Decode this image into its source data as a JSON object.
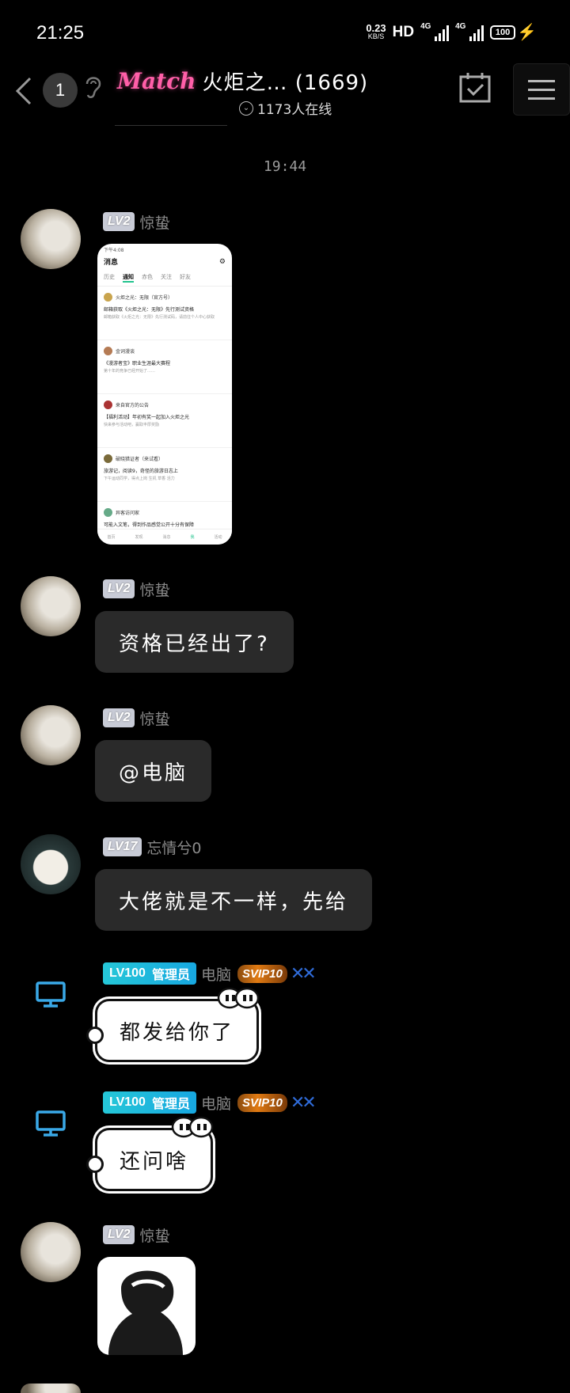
{
  "status_bar": {
    "time": "21:25",
    "net_speed_value": "0.23",
    "net_speed_unit": "KB/S",
    "hd_label": "HD",
    "signal1_label": "4G",
    "signal2_label": "4G",
    "battery": "100"
  },
  "header": {
    "back_badge": "1",
    "match_logo": "Match",
    "title": "火炬之… (1669)",
    "online": "1173人在线"
  },
  "timestamp": "19:44",
  "messages": [
    {
      "level": "LV2",
      "nick": "惊蛰",
      "type": "image"
    },
    {
      "level": "LV2",
      "nick": "惊蛰",
      "text": "资格已经出了?"
    },
    {
      "level": "LV2",
      "nick": "惊蛰",
      "text": "@电脑"
    },
    {
      "level": "LV17",
      "nick": "忘情兮0",
      "text": "大佬就是不一样，先给"
    },
    {
      "level": "LV100",
      "role": "管理员",
      "nick": "电脑",
      "vip": "SVIP10",
      "text": "都发给你了"
    },
    {
      "level": "LV100",
      "role": "管理员",
      "nick": "电脑",
      "vip": "SVIP10",
      "text": "还问啥"
    },
    {
      "level": "LV2",
      "nick": "惊蛰",
      "type": "sticker"
    }
  ],
  "screenshot_preview": {
    "status": "下午4:08",
    "title": "消息",
    "tabs": [
      "历史",
      "通知",
      "赤色",
      "关注",
      "好友"
    ],
    "items": [
      {
        "who": "火炬之光：无限（官方号）",
        "line1": "邮箱获取《火炬之光：无限》先行测试资格",
        "line2": "邮箱获取《火炬之光：无限》先行测试码，请前往个人中心获取"
      },
      {
        "who": "金词漫谈",
        "line1": "《漫游者宝》职业生涯最大赛程",
        "line2": "第十年的竞争已经开始了……"
      },
      {
        "who": "来自官方的公告",
        "line1": "【福利活动】年初有奖一起加入火炬之光",
        "line2": "快来参与活动吧，赢取丰厚奖励"
      },
      {
        "who": "破晓猎证者（来试看）",
        "line1": "旅游记，阅读9，奇怪的旅游日志上",
        "line2": "下午运动同学，得点上岗 生机 草香 活力"
      },
      {
        "who": "异客访问家",
        "line1": "可能入文笔，得到作品感觉公开十分有保障",
        "line2": ""
      }
    ],
    "nav": [
      "首页",
      "发现",
      "消息",
      "我",
      "活动"
    ]
  },
  "colors": {
    "accent_match": "#ff5fa8",
    "admin_badge": "#25c7d8",
    "level_badge": "#c8cbd6",
    "bubble_dark": "#2a2a2a",
    "pc_icon": "#3aa9e8"
  }
}
